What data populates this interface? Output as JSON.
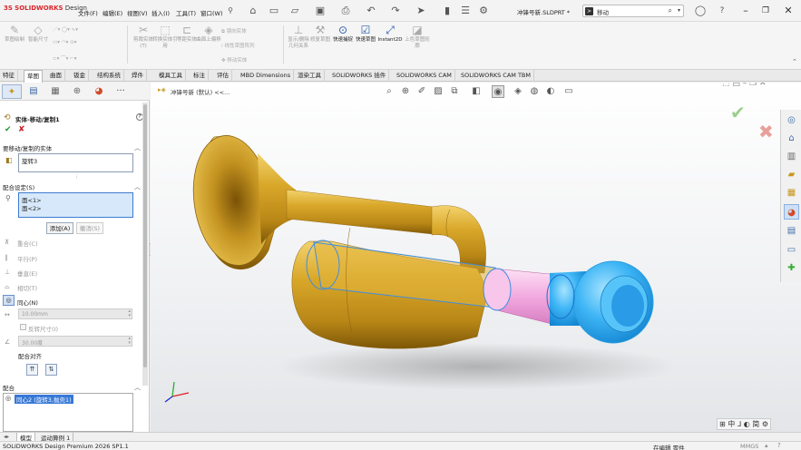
{
  "app": {
    "logo_mark": "3S",
    "logo_brand": "SOLIDWORKS",
    "logo_suffix": "Design",
    "document": "冲锋号新.SLDPRT *"
  },
  "menus": [
    "文件(F)",
    "编辑(E)",
    "视图(V)",
    "插入(I)",
    "工具(T)",
    "窗口(W)"
  ],
  "search": {
    "value": "移动",
    "prefix": ">"
  },
  "commands": [
    {
      "label": "草图绘制",
      "icon": "sketch-icon",
      "active": false
    },
    {
      "label": "智能尺寸",
      "icon": "smart-dimension-icon",
      "active": false
    },
    {
      "label": "剪裁实体(T)",
      "icon": "trim-icon",
      "active": false
    },
    {
      "label": "转换实体引用",
      "icon": "convert-icon",
      "active": false
    },
    {
      "label": "等距实体",
      "icon": "offset-icon",
      "active": false
    },
    {
      "label": "曲面上偏移",
      "icon": "surface-offset-icon",
      "active": false
    },
    {
      "label": "显示/删除几何关系",
      "icon": "relations-icon",
      "active": false
    },
    {
      "label": "修复草图",
      "icon": "repair-sketch-icon",
      "active": false
    },
    {
      "label": "快速捕捉",
      "icon": "quick-snap-icon",
      "active": true
    },
    {
      "label": "快速草图",
      "icon": "rapid-sketch-icon",
      "active": true
    },
    {
      "label": "Instant2D",
      "icon": "instant2d-icon",
      "active": true
    },
    {
      "label": "上色草图轮廓",
      "icon": "shaded-sketch-icon",
      "active": false
    }
  ],
  "command_small": [
    "镜向实体",
    "线性草图阵列",
    "移动实体"
  ],
  "tabs": [
    "特征",
    "草图",
    "曲面",
    "钣金",
    "结构系统",
    "焊件",
    "模具工具",
    "标注",
    "评估",
    "MBD Dimensions",
    "渲染工具",
    "SOLIDWORKS 插件",
    "SOLIDWORKS CAM",
    "SOLIDWORKS CAM TBM"
  ],
  "active_tab": "草图",
  "panel": {
    "title": "实体-移动/复制1",
    "help": "?",
    "section_bodies": "要移动/复制的实体",
    "bodies": [
      "旋转3"
    ],
    "section_mates": "配合设定(S)",
    "mate_refs": [
      "面<1>",
      "面<2>"
    ],
    "add_button": "添加(A)",
    "cancel_button": "撤消(S)",
    "mate_types": [
      "重合(C)",
      "平行(P)",
      "垂直(E)",
      "相切(T)",
      "同心(N)"
    ],
    "active_mate": "同心(N)",
    "distance": "10.00mm",
    "flip_dim": "反转尺寸(I)",
    "angle": "30.00度",
    "align_label": "配合对齐",
    "section_list": "配合",
    "mate_entry": "同心2 (旋转3,抛壳1)"
  },
  "view": {
    "tree_label": "冲锋号新 (默认) <<..."
  },
  "bottom_tabs": [
    "模型",
    "运动算例 1"
  ],
  "status": {
    "left": "SOLIDWORKS Design Premium 2026 SP1.1",
    "mid": "在编辑 零件",
    "units": "MMGS"
  },
  "colors": {
    "brass": "#c8971a",
    "pink": "#f2a9df",
    "blue": "#3fb4f5",
    "brand": "#d8262c"
  }
}
